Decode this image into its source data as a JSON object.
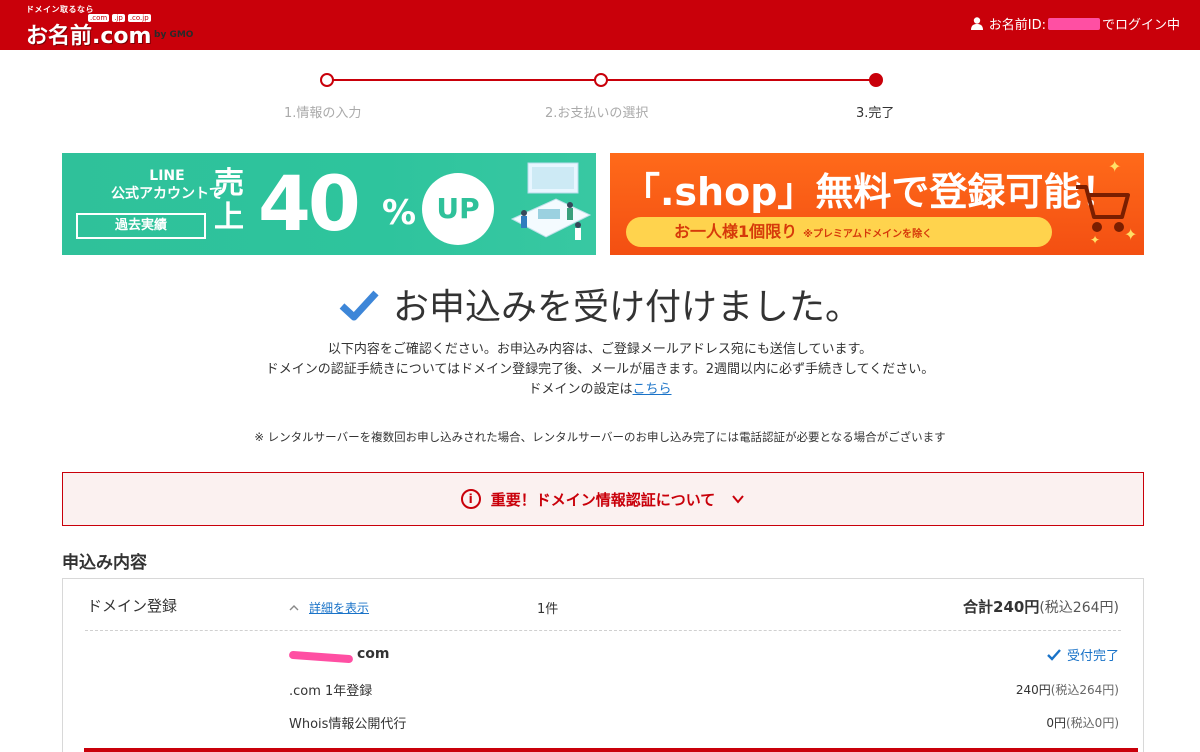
{
  "header": {
    "logo": {
      "tagline": "ドメイン取るなら",
      "tlds": [
        ".com",
        ".jp",
        ".co.jp"
      ],
      "name": "お名前.com",
      "sub": "by GMO"
    },
    "login_prefix": "お名前ID:",
    "login_suffix": "でログイン中"
  },
  "steps": [
    {
      "label": "1.情報の入力"
    },
    {
      "label": "2.お支払いの選択"
    },
    {
      "label": "3.完了"
    }
  ],
  "banner_line": {
    "line1": "LINE",
    "line2": "公式アカウントで",
    "box": "過去実績",
    "sale": "売上",
    "number": "40",
    "percent": "%",
    "up": "UP"
  },
  "banner_shop": {
    "headline": "「.shop」無料で登録可能！",
    "pill": "お一人様1個限り",
    "pill_note": "※プレミアムドメインを除く"
  },
  "confirmation": {
    "title": "お申込みを受け付けました。",
    "desc_line1": "以下内容をご確認ください。お申込み内容は、ご登録メールアドレス宛にも送信しています。",
    "desc_line2": "ドメインの認証手続きについてはドメイン登録完了後、メールが届きます。2週間以内に必ず手続きしてください。",
    "desc_line3_prefix": "ドメインの設定は",
    "desc_link": "こちら",
    "note": "※ レンタルサーバーを複数回お申し込みされた場合、レンタルサーバーのお申し込み完了には電話認証が必要となる場合がございます"
  },
  "important": {
    "label": "重要！ドメイン情報認証について"
  },
  "order": {
    "section_title": "申込み内容",
    "category": "ドメイン登録",
    "detail_toggle": "詳細を表示",
    "count": "1件",
    "total_label": "合計240円",
    "total_tax": "(税込264円)",
    "domain_suffix": "com",
    "status": "受付完了",
    "items": [
      {
        "name": ".com 1年登録",
        "price": "240円",
        "tax": "(税込264円)"
      },
      {
        "name": "Whois情報公開代行",
        "price": "0円",
        "tax": "(税込0円)"
      }
    ]
  },
  "colors": {
    "brand_red": "#c9000a",
    "link_blue": "#1a73c8",
    "line_green": "#2fc19a",
    "shop_orange": "#f35a14"
  }
}
